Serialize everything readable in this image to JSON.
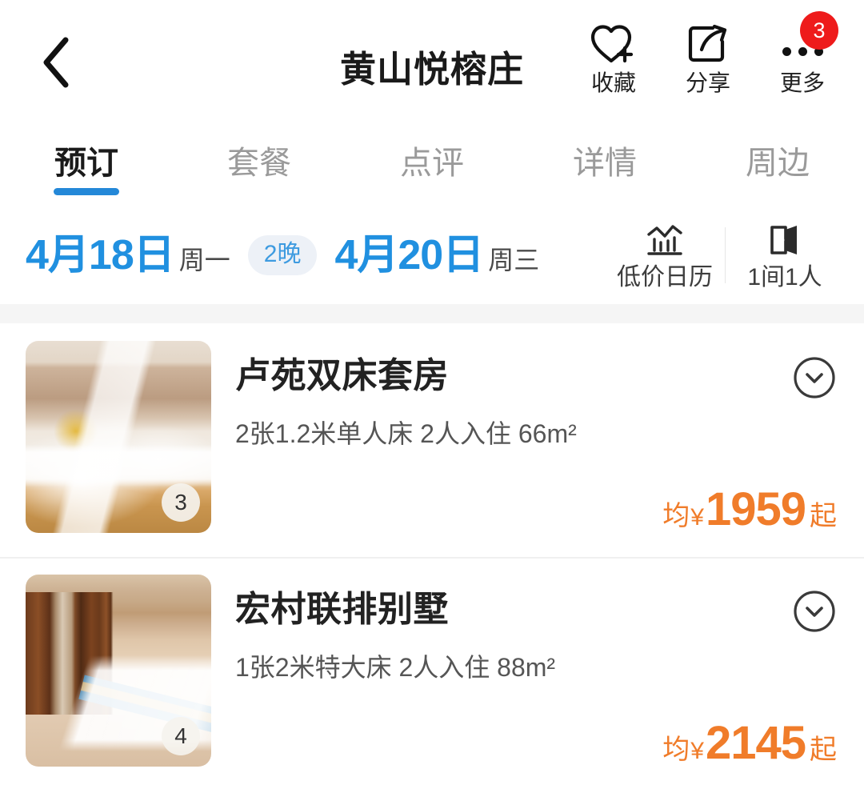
{
  "header": {
    "back_icon": "chevron-left-icon",
    "title": "黄山悦榕庄",
    "actions": [
      {
        "icon": "heart-plus-icon",
        "label": "收藏",
        "badge": null
      },
      {
        "icon": "share-icon",
        "label": "分享",
        "badge": null
      },
      {
        "icon": "more-dots-icon",
        "label": "更多",
        "badge": "3"
      }
    ]
  },
  "tabs": [
    {
      "label": "预订",
      "active": true
    },
    {
      "label": "套餐",
      "active": false
    },
    {
      "label": "点评",
      "active": false
    },
    {
      "label": "详情",
      "active": false
    },
    {
      "label": "周边",
      "active": false
    }
  ],
  "date_bar": {
    "checkin_date": "4月18日",
    "checkin_weekday": "周一",
    "nights": "2晚",
    "checkout_date": "4月20日",
    "checkout_weekday": "周三",
    "options": [
      {
        "icon": "low-price-calendar-icon",
        "label": "低价日历"
      },
      {
        "icon": "room-guest-icon",
        "label": "1间1人"
      }
    ]
  },
  "rooms": [
    {
      "title": "卢苑双床套房",
      "desc": "2张1.2米单人床  2人入住  66m²",
      "photo_count": "3",
      "price_prefix": "均",
      "currency": "¥",
      "price": "1959",
      "price_suffix": "起",
      "expand_icon": "chevron-down-circle-icon"
    },
    {
      "title": "宏村联排别墅",
      "desc": "1张2米特大床  2人入住  88m²",
      "photo_count": "4",
      "price_prefix": "均",
      "currency": "¥",
      "price": "2145",
      "price_suffix": "起",
      "expand_icon": "chevron-down-circle-icon"
    }
  ],
  "colors": {
    "accent_blue": "#2090E0",
    "price_orange": "#F07C2A",
    "badge_red": "#EE1B1B",
    "tab_active": "#1a1a1a",
    "tab_inactive": "#9a9a9a"
  }
}
